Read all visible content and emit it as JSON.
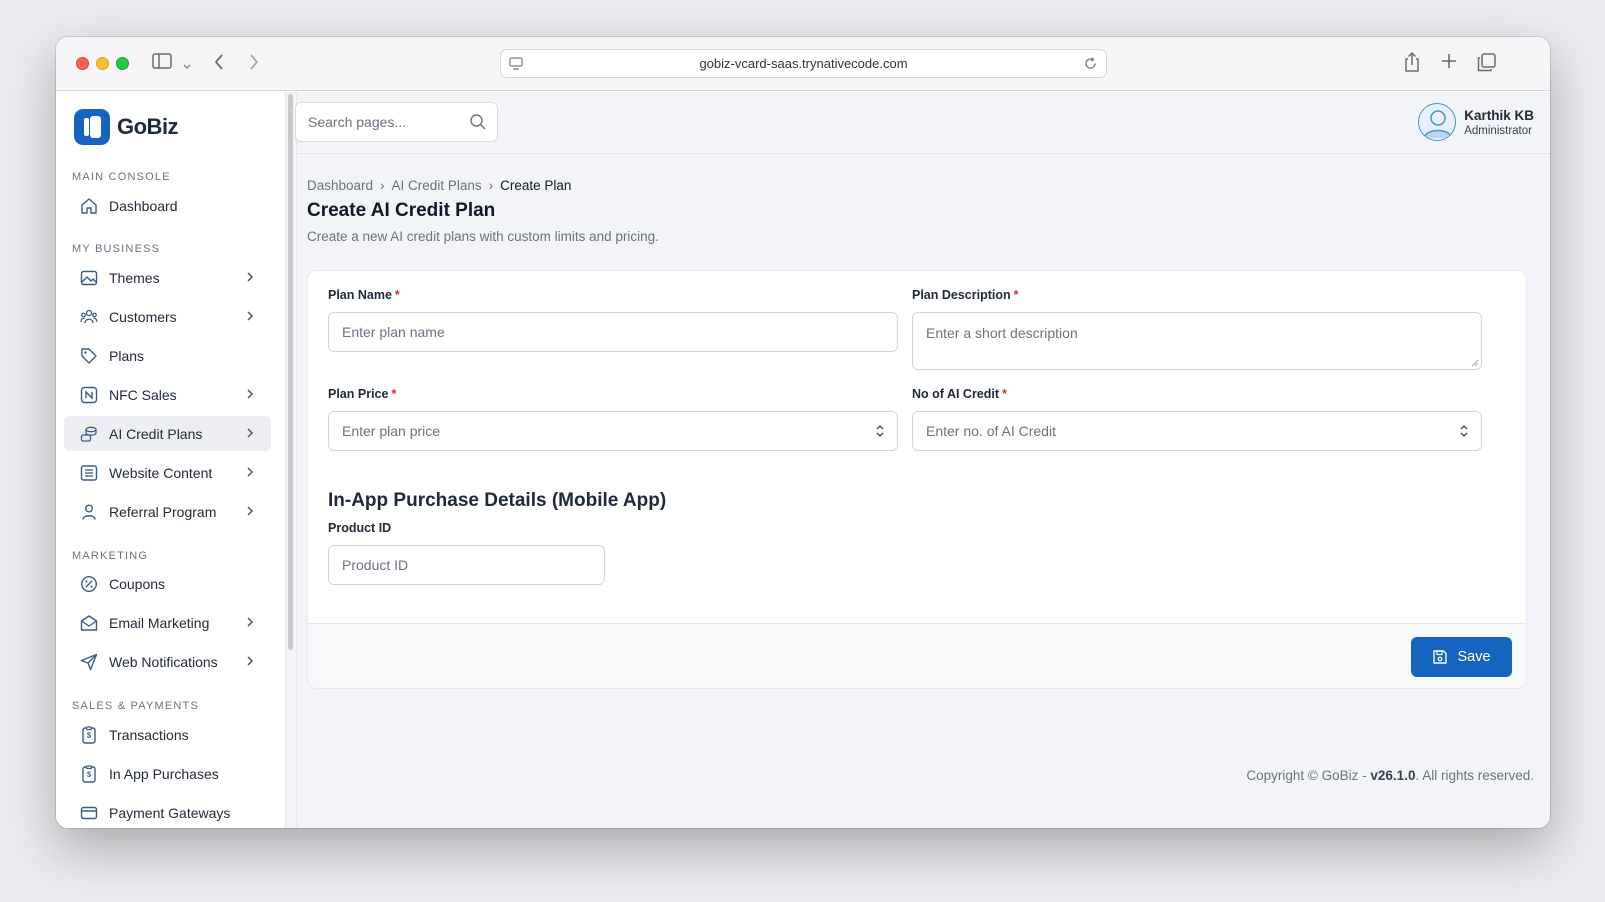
{
  "browser": {
    "url": "gobiz-vcard-saas.trynativecode.com"
  },
  "sidebar": {
    "logo_text": "GoBiz",
    "sections": {
      "main_console": "MAIN CONSOLE",
      "my_business": "MY BUSINESS",
      "marketing": "MARKETING",
      "sales_payments": "SALES & PAYMENTS"
    },
    "items": [
      {
        "label": "Dashboard",
        "icon": "home-icon"
      },
      {
        "label": "Themes",
        "icon": "image-icon"
      },
      {
        "label": "Customers",
        "icon": "users-icon"
      },
      {
        "label": "Plans",
        "icon": "tag-icon"
      },
      {
        "label": "NFC Sales",
        "icon": "nfc-icon"
      },
      {
        "label": "AI Credit Plans",
        "icon": "coins-icon"
      },
      {
        "label": "Website Content",
        "icon": "document-icon"
      },
      {
        "label": "Referral Program",
        "icon": "user-icon"
      },
      {
        "label": "Coupons",
        "icon": "discount-icon"
      },
      {
        "label": "Email Marketing",
        "icon": "mail-icon"
      },
      {
        "label": "Web Notifications",
        "icon": "send-icon"
      },
      {
        "label": "Transactions",
        "icon": "receipt-icon"
      },
      {
        "label": "In App Purchases",
        "icon": "receipt-icon"
      },
      {
        "label": "Payment Gateways",
        "icon": "card-icon"
      }
    ]
  },
  "header": {
    "search_placeholder": "Search pages...",
    "user_name": "Karthik KB",
    "user_role": "Administrator"
  },
  "breadcrumb": [
    "Dashboard",
    "AI Credit Plans",
    "Create Plan"
  ],
  "page": {
    "title": "Create AI Credit Plan",
    "subtitle": "Create a new AI credit plans with custom limits and pricing."
  },
  "form": {
    "plan_name_label": "Plan Name",
    "plan_name_placeholder": "Enter plan name",
    "plan_description_label": "Plan Description",
    "plan_description_placeholder": "Enter a short description",
    "plan_price_label": "Plan Price",
    "plan_price_placeholder": "Enter plan price",
    "ai_credit_label": "No of AI Credit",
    "ai_credit_placeholder": "Enter no. of AI Credit",
    "required_mark": "*",
    "iap_heading": "In-App Purchase Details (Mobile App)",
    "product_id_label": "Product ID",
    "product_id_placeholder": "Product ID",
    "save_label": "Save"
  },
  "footer": {
    "prefix": "Copyright © GoBiz - ",
    "version": "v26.1.0",
    "suffix": ". All rights reserved."
  },
  "colors": {
    "brand": "#1565c0",
    "required": "#dc2626"
  }
}
